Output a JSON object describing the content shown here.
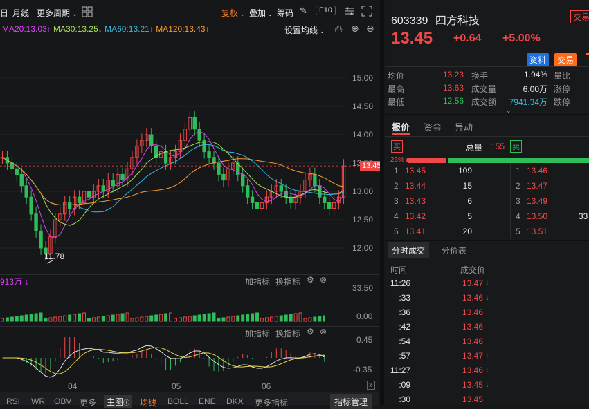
{
  "toolbar": {
    "period_day": "日",
    "period_month": "月线",
    "more_period": "更多周期",
    "fuquan": "复权",
    "overlay": "叠加",
    "chips": "筹码",
    "f10": "F10"
  },
  "ma_legend": {
    "ma20": "MA20:13.03",
    "ma30": "MA30:13.25",
    "ma60": "MA60:13.21",
    "ma120": "MA120:13.43",
    "settings": "设置均线",
    "colors": {
      "ma20": "#e040fb",
      "ma30": "#a8e05a",
      "ma60": "#3bb8d8",
      "ma120": "#ff9a2e"
    }
  },
  "price_axis": [
    "15.00",
    "14.50",
    "14.00",
    "13.50",
    "13.00",
    "12.50",
    "12.00"
  ],
  "current_price_tag": "13.45",
  "low_marker": "11.78",
  "volume_panel": {
    "label": "913万",
    "add": "加指标",
    "switch": "换指标",
    "axis_top": "33.50",
    "axis_bottom": "0.00"
  },
  "macd_panel": {
    "add": "加指标",
    "switch": "换指标",
    "axis_top": "0.45",
    "axis_bottom": "-0.35"
  },
  "x_axis": [
    "04",
    "05",
    "06"
  ],
  "bottom_tabs": {
    "rsi": "RSI",
    "wr": "WR",
    "obv": "OBV",
    "more": "更多",
    "main": "主图",
    "ma": "均线",
    "boll": "BOLL",
    "ene": "ENE",
    "dkx": "DKX",
    "more_ind": "更多指标",
    "manage": "指标管理"
  },
  "stock": {
    "code": "603339",
    "name": "四方科技",
    "trade_tag": "交易",
    "price": "13.45",
    "change": "+0.64",
    "change_pct": "+5.00%",
    "info_btn": "资料",
    "trade_btn": "交易"
  },
  "stats": [
    {
      "label": "均价",
      "value": "13.23",
      "label2": "换手",
      "value2": "1.94%",
      "label3": "量比"
    },
    {
      "label": "最高",
      "value": "13.63",
      "label2": "成交量",
      "value2": "6.00万",
      "label3": "涨停"
    },
    {
      "label": "最低",
      "value": "12.56",
      "label2": "成交额",
      "value2": "7941.34万",
      "label3": "跌停"
    }
  ],
  "quote_tabs": {
    "quote": "报价",
    "fund": "资金",
    "abnormal": "异动"
  },
  "orderbook": {
    "buy": "买",
    "total": "总量",
    "total_val": "155",
    "sell": "卖",
    "pct": "26%",
    "bids": [
      [
        "1",
        "13.45",
        "109"
      ],
      [
        "2",
        "13.44",
        "15"
      ],
      [
        "3",
        "13.43",
        "6"
      ],
      [
        "4",
        "13.42",
        "5"
      ],
      [
        "5",
        "13.41",
        "20"
      ]
    ],
    "asks": [
      [
        "1",
        "13.46",
        ""
      ],
      [
        "2",
        "13.47",
        ""
      ],
      [
        "3",
        "13.49",
        ""
      ],
      [
        "4",
        "13.50",
        "33"
      ],
      [
        "5",
        "13.51",
        ""
      ]
    ]
  },
  "trade_tabs": {
    "ticks": "分时成交",
    "price_table": "分价表"
  },
  "trade_header": {
    "time": "时间",
    "price": "成交价"
  },
  "trades": [
    {
      "time": "11:26",
      "price": "13.47",
      "dir": "down"
    },
    {
      "time": ":33",
      "price": "13.46",
      "dir": "down"
    },
    {
      "time": ":36",
      "price": "13.46",
      "dir": ""
    },
    {
      "time": ":42",
      "price": "13.46",
      "dir": ""
    },
    {
      "time": ":54",
      "price": "13.46",
      "dir": ""
    },
    {
      "time": ":57",
      "price": "13.47",
      "dir": "up"
    },
    {
      "time": "11:27",
      "price": "13.46",
      "dir": "down"
    },
    {
      "time": ":09",
      "price": "13.45",
      "dir": "down"
    },
    {
      "time": ":30",
      "price": "13.45",
      "dir": ""
    }
  ]
}
